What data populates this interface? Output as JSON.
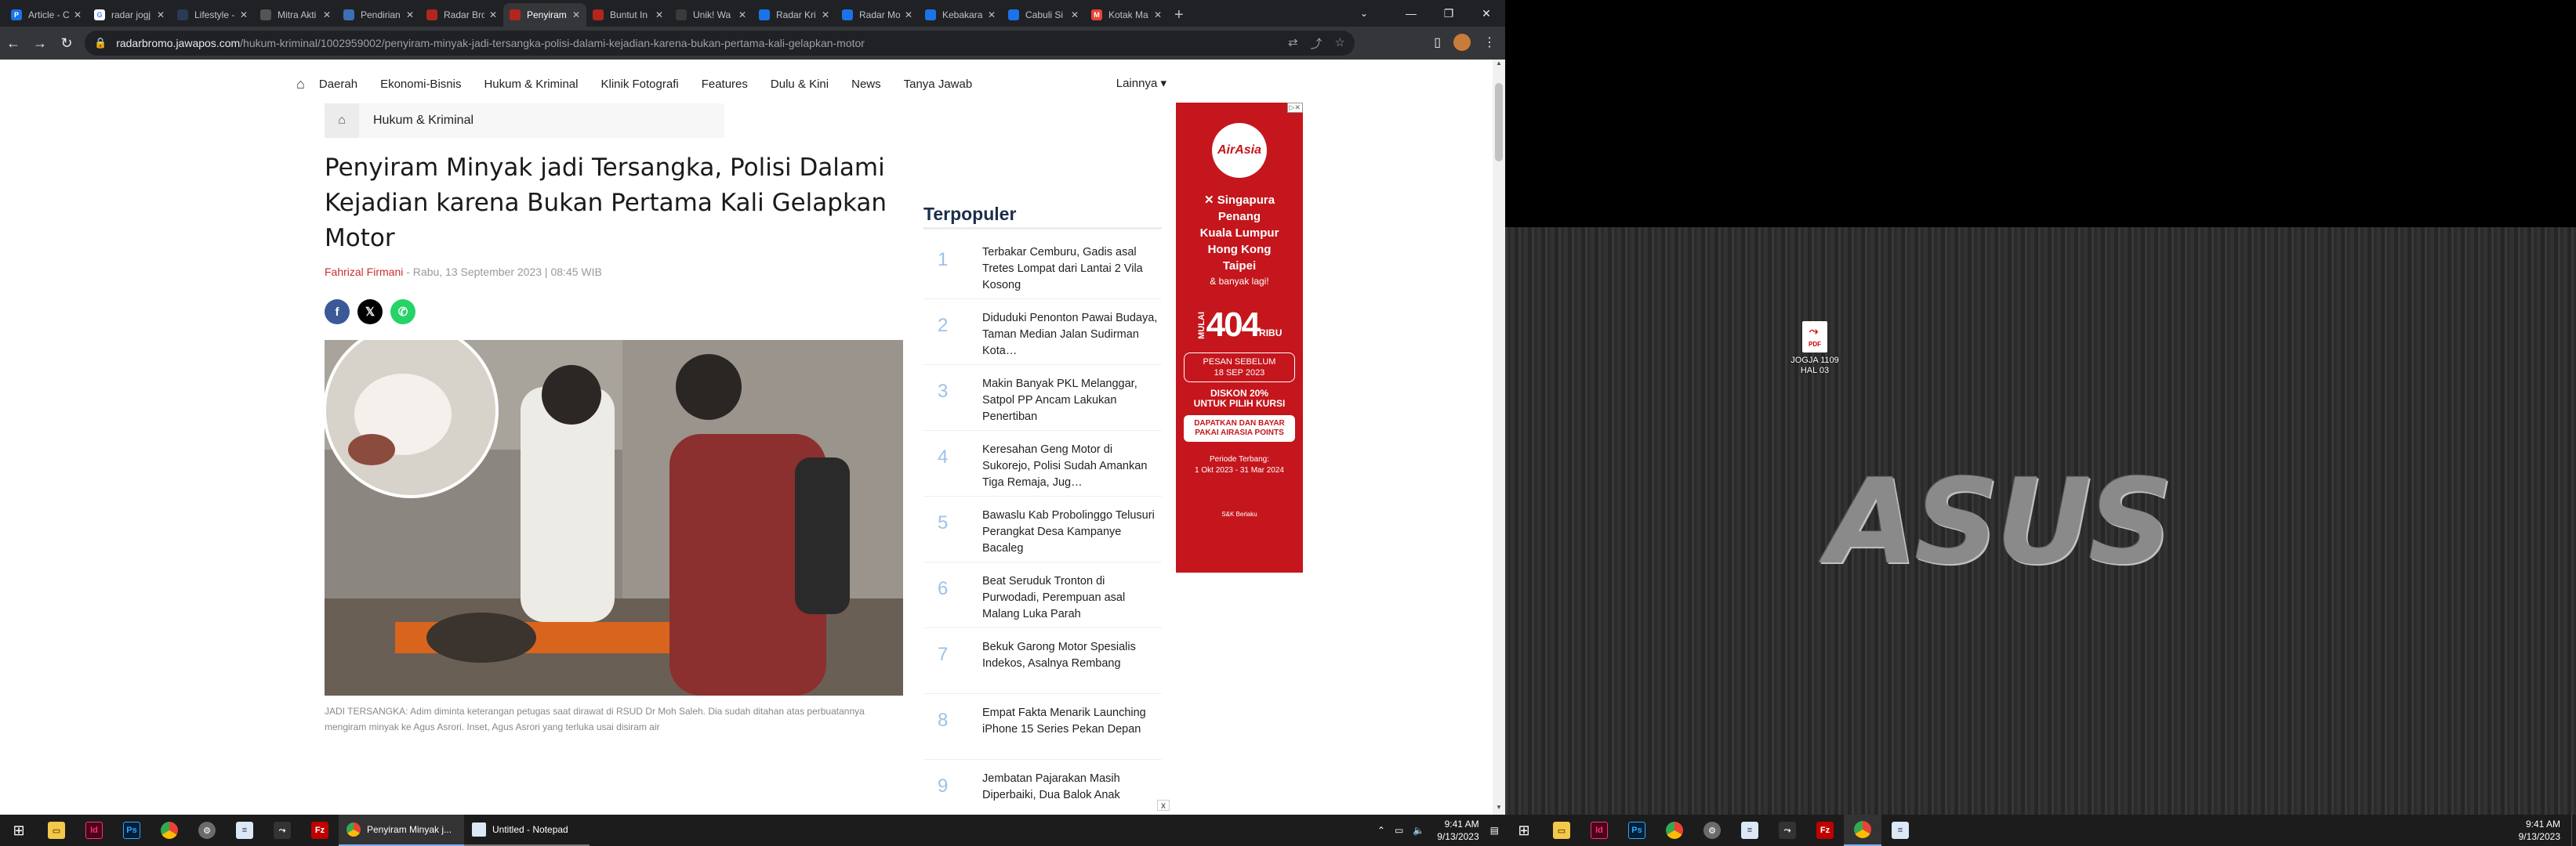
{
  "browser": {
    "tabs": [
      {
        "title": "Article - C",
        "fav_letter": "P",
        "fav_color": "#1a73e8"
      },
      {
        "title": "radar jogj",
        "fav_letter": "G",
        "fav_color": "#ffffff"
      },
      {
        "title": "Lifestyle -",
        "fav_letter": "",
        "fav_color": "#2b3a55"
      },
      {
        "title": "Mitra Akti",
        "fav_letter": "",
        "fav_color": "#555555"
      },
      {
        "title": "Pendirian",
        "fav_letter": "",
        "fav_color": "#3d6fb6"
      },
      {
        "title": "Radar Bro",
        "fav_letter": "",
        "fav_color": "#b3261e"
      },
      {
        "title": "Penyiram",
        "fav_letter": "",
        "fav_color": "#b3261e",
        "active": true
      },
      {
        "title": "Buntut In",
        "fav_letter": "",
        "fav_color": "#b3261e"
      },
      {
        "title": "Unik! Wa",
        "fav_letter": "",
        "fav_color": "#3a3a3a"
      },
      {
        "title": "Radar Kri",
        "fav_letter": "",
        "fav_color": "#1a73e8"
      },
      {
        "title": "Radar Mo",
        "fav_letter": "",
        "fav_color": "#1a73e8"
      },
      {
        "title": "Kebakara",
        "fav_letter": "",
        "fav_color": "#1a73e8"
      },
      {
        "title": "Cabuli Si",
        "fav_letter": "",
        "fav_color": "#1a73e8"
      },
      {
        "title": "Kotak Ma",
        "fav_letter": "M",
        "fav_color": "#ea4335"
      }
    ],
    "new_tab": "+",
    "url_domain": "radarbromo.jawapos.com",
    "url_path": "/hukum-kriminal/1002959002/penyiram-minyak-jadi-tersangka-polisi-dalami-kejadian-karena-bukan-pertama-kali-gelapkan-motor"
  },
  "site": {
    "nav": [
      "Daerah",
      "Ekonomi-Bisnis",
      "Hukum & Kriminal",
      "Klinik Fotografi",
      "Features",
      "Dulu & Kini",
      "News",
      "Tanya Jawab"
    ],
    "nav_more": "Lainnya",
    "breadcrumb": "Hukum & Kriminal"
  },
  "article": {
    "headline": "Penyiram Minyak jadi Tersangka, Polisi Dalami Kejadian karena Bukan Pertama Kali Gelapkan Motor",
    "author": "Fahrizal Firmani",
    "date": " - Rabu, 13 September 2023 | 08:45 WIB",
    "caption": "JADI TERSANGKA: Adim diminta keterangan petugas saat dirawat di RSUD Dr Moh Saleh. Dia sudah ditahan atas perbuatannya mengiram minyak ke Agus Asrori. Inset, Agus Asrori yang terluka usai disiram air"
  },
  "popular": {
    "title": "Terpopuler",
    "items": [
      {
        "num": "1",
        "text": "Terbakar Cemburu, Gadis asal Tretes Lompat dari Lantai 2 Vila Kosong"
      },
      {
        "num": "2",
        "text": "Diduduki Penonton Pawai Budaya, Taman Median Jalan Sudirman Kota…"
      },
      {
        "num": "3",
        "text": "Makin Banyak PKL Melanggar, Satpol PP Ancam Lakukan Penertiban"
      },
      {
        "num": "4",
        "text": "Keresahan Geng Motor di Sukorejo, Polisi Sudah Amankan Tiga Remaja, Jug…"
      },
      {
        "num": "5",
        "text": "Bawaslu Kab Probolinggo Telusuri Perangkat Desa Kampanye Bacaleg"
      },
      {
        "num": "6",
        "text": "Beat Seruduk Tronton di Purwodadi, Perempuan asal Malang Luka Parah"
      },
      {
        "num": "7",
        "text": "Bekuk Garong Motor Spesialis Indekos, Asalnya Rembang"
      },
      {
        "num": "8",
        "text": "Empat Fakta Menarik Launching iPhone 15 Series Pekan Depan"
      },
      {
        "num": "9",
        "text": "Jembatan Pajarakan Masih Diperbaiki, Dua Balok Anak"
      }
    ]
  },
  "ad": {
    "brand": "AirAsia",
    "destinations": [
      "✕ Singapura",
      "Penang",
      "Kuala Lumpur",
      "Hong Kong",
      "Taipei"
    ],
    "more": "& banyak lagi!",
    "price_prefix": "MULAI",
    "price": "404",
    "price_suffix": "RIBU",
    "book_before": "PESAN SEBELUM\n18 SEP 2023",
    "discount": "DISKON 20%\nUNTUK PILIH KURSI",
    "points": "DAPATKAN DAN BAYAR\nPAKAI AIRASIA POINTS",
    "period": "Periode Terbang:\n1 Okt 2023 - 31 Mar 2024",
    "tnc": "S&K Berlaku",
    "close": "x"
  },
  "taskbar": {
    "app1": "Penyiram Minyak j...",
    "app2": "Untitled - Notepad",
    "time": "9:41 AM",
    "date": "9/13/2023"
  },
  "desktop2": {
    "icon_label": "JOGJA 1109\nHAL 03",
    "brand": "ASUS",
    "time": "9:41 AM",
    "date": "9/13/2023"
  }
}
